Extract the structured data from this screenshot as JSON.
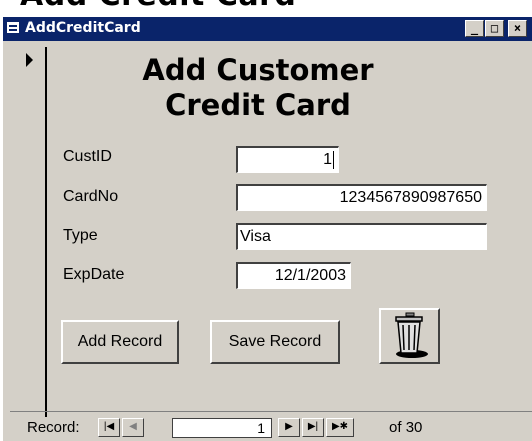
{
  "background_title": "Add Credit Card",
  "window": {
    "title": "AddCreditCard",
    "minimize": "_",
    "restore": "□",
    "close": "×"
  },
  "form": {
    "heading_line1": "Add Customer",
    "heading_line2": "Credit Card",
    "fields": {
      "custid": {
        "label": "CustID",
        "value": "1"
      },
      "cardno": {
        "label": "CardNo",
        "value": "1234567890987650"
      },
      "type": {
        "label": "Type",
        "value": "Visa"
      },
      "expdate": {
        "label": "ExpDate",
        "value": "12/1/2003"
      }
    },
    "add_record_label": "Add Record",
    "save_record_label": "Save Record"
  },
  "navigation": {
    "label": "Record:",
    "current": "1",
    "of_label": "of",
    "total": "30"
  },
  "colors": {
    "title_bar": "#0a246a",
    "window_face": "#d4d0c8"
  }
}
